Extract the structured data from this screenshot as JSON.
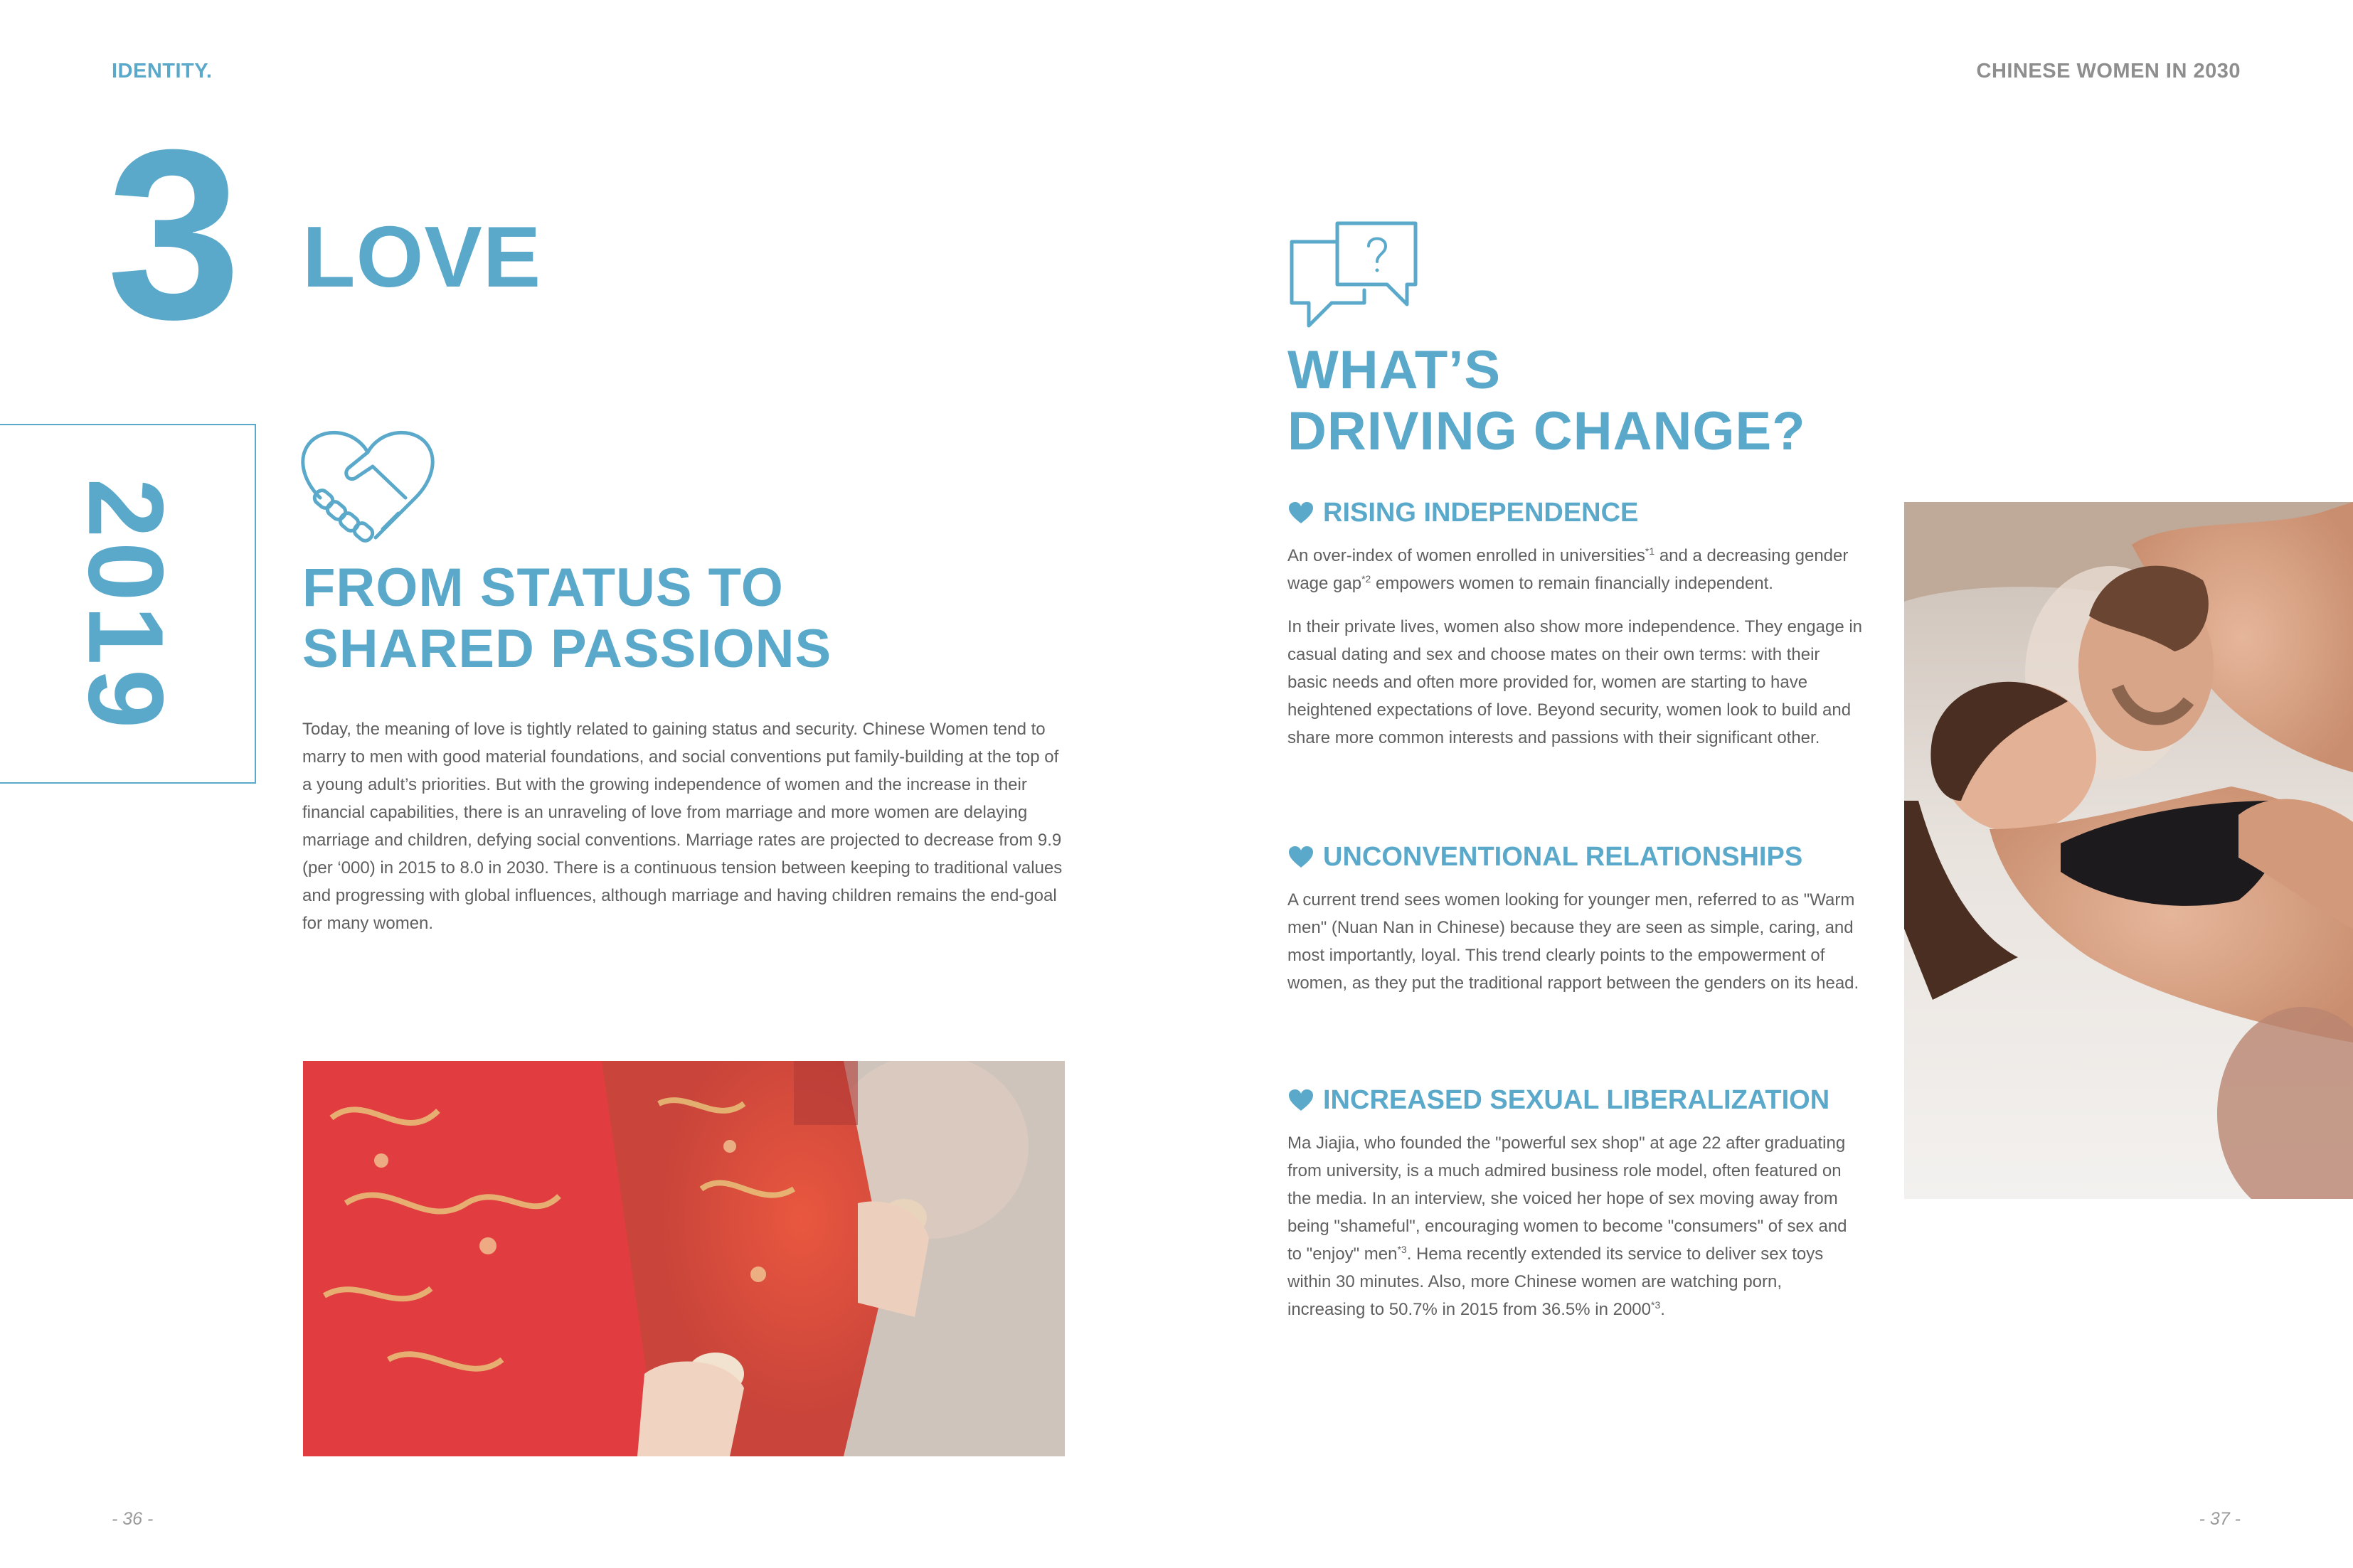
{
  "header": {
    "left": "IDENTITY.",
    "right": "CHINESE WOMEN IN 2030"
  },
  "chapter": {
    "number": "3",
    "title": "LOVE",
    "year": "2019"
  },
  "left_section": {
    "icon": "handshake-heart-icon",
    "heading_line1": "FROM STATUS TO",
    "heading_line2": "SHARED PASSIONS",
    "paragraph": "Today, the meaning of love is tightly related to gaining status and security. Chinese Women tend to marry to men with good material foundations, and social conventions put family-building at the top of a young adult’s priorities.  But with the growing independence of women and the increase in their financial capabilities, there is an unraveling of love from marriage and more women are delaying marriage and children, defying social conventions. Marriage rates are projected to decrease from 9.9 (per ‘000) in 2015 to 8.0 in 2030. There is a continuous tension between keeping to traditional values and progressing with global influences, although marriage and having children remains the end-goal for many women.",
    "image": "wedding-tea-ceremony-photo"
  },
  "right_section": {
    "icon": "chat-question-icon",
    "heading_line1": "WHAT’S",
    "heading_line2": "DRIVING CHANGE?",
    "image": "couple-embracing-photo",
    "subsections": [
      {
        "title": "RISING INDEPENDENCE",
        "p1_a": "An over-index of women enrolled in universities",
        "p1_sup1": "*1",
        "p1_b": " and a decreasing gender wage gap",
        "p1_sup2": "*2",
        "p1_c": " empowers women to remain financially independent.",
        "p2": "In their private lives, women also show more independence. They engage in casual dating and sex and choose mates on their own terms: with their basic needs and often more provided for, women are starting to have heightened expectations of love. Beyond security, women look to build and share more common interests and passions with their significant other."
      },
      {
        "title": "UNCONVENTIONAL RELATIONSHIPS",
        "p1": "A current trend sees women looking for younger men, referred to as \"Warm men\" (Nuan Nan in Chinese) because they are seen as simple, caring, and most importantly, loyal. This trend clearly points to the empowerment of women, as they put the traditional rapport between the genders on its head."
      },
      {
        "title": "INCREASED SEXUAL LIBERALIZATION",
        "p1_a": "Ma Jiajia, who founded the \"powerful sex shop\" at age 22 after graduating from university, is a much admired business role model, often featured on the media.  In an interview, she voiced her hope of sex moving away from being \"shameful\", encouraging women to become \"consumers\" of sex and to \"enjoy\" men",
        "p1_sup1": "*3",
        "p1_b": ". Hema recently extended its service to deliver sex toys within 30 minutes. Also, more Chinese women are watching porn, increasing to 50.7% in 2015 from 36.5% in 2000",
        "p1_sup2": "*3",
        "p1_c": "."
      }
    ]
  },
  "footer": {
    "left_page": "- 36 -",
    "right_page": "- 37 -"
  },
  "colors": {
    "accent": "#5aa9cb",
    "body_text": "#5f5f5f",
    "header_gray": "#8e8e8e"
  }
}
